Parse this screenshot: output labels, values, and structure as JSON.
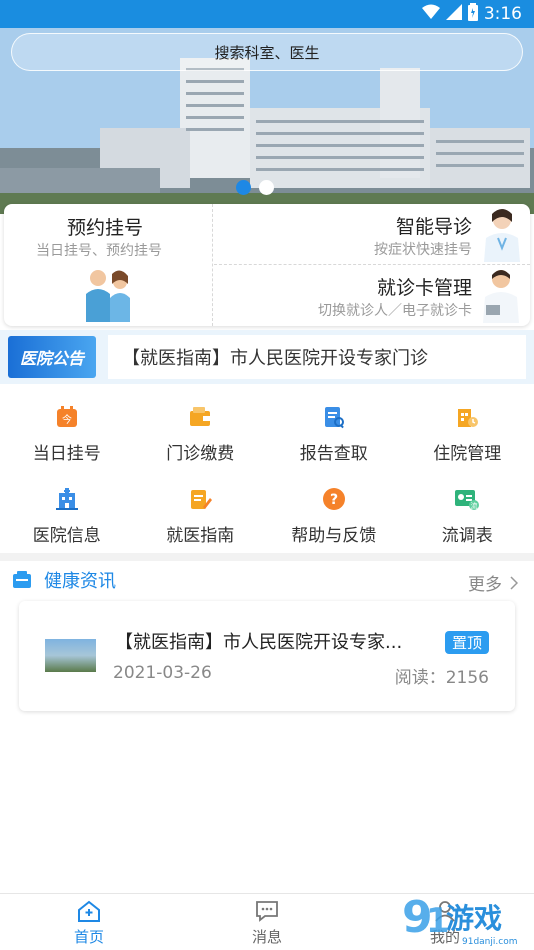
{
  "status_bar": {
    "time": "3:16"
  },
  "search": {
    "placeholder": "搜索科室、医生"
  },
  "services": {
    "appointment": {
      "title": "预约挂号",
      "subtitle": "当日挂号、预约挂号"
    },
    "smart_guide": {
      "title": "智能导诊",
      "subtitle": "按症状快速挂号"
    },
    "card_manage": {
      "title": "就诊卡管理",
      "subtitle": "切换就诊人／电子就诊卡"
    }
  },
  "notice": {
    "logo_text": "医院公告",
    "text": "【就医指南】市人民医院开设专家门诊"
  },
  "grid": [
    {
      "label": "当日挂号",
      "icon": "calendar-icon",
      "color": "#f5822a"
    },
    {
      "label": "门诊缴费",
      "icon": "wallet-icon",
      "color": "#f5a623"
    },
    {
      "label": "报告查取",
      "icon": "report-icon",
      "color": "#3a8ee6"
    },
    {
      "label": "住院管理",
      "icon": "building-icon",
      "color": "#f5a623"
    },
    {
      "label": "医院信息",
      "icon": "hospital-icon",
      "color": "#3a8ee6"
    },
    {
      "label": "就医指南",
      "icon": "guide-icon",
      "color": "#f5a623"
    },
    {
      "label": "帮助与反馈",
      "icon": "help-icon",
      "color": "#f5822a"
    },
    {
      "label": "流调表",
      "icon": "idcard-icon",
      "color": "#2fb37b"
    }
  ],
  "health": {
    "title": "健康资讯",
    "more": "更多"
  },
  "news": [
    {
      "title": "【就医指南】市人民医院开设专家...",
      "date": "2021-03-26",
      "badge": "置顶",
      "reads": "阅读：2156"
    }
  ],
  "tabs": [
    {
      "label": "首页",
      "icon": "home-icon"
    },
    {
      "label": "消息",
      "icon": "message-icon"
    },
    {
      "label": "我的",
      "icon": "user-icon"
    }
  ],
  "watermark": {
    "text": "游戏",
    "sub": "91danji.com"
  },
  "colors": {
    "primary": "#1e88e5",
    "status_bar": "#1a8de0"
  }
}
